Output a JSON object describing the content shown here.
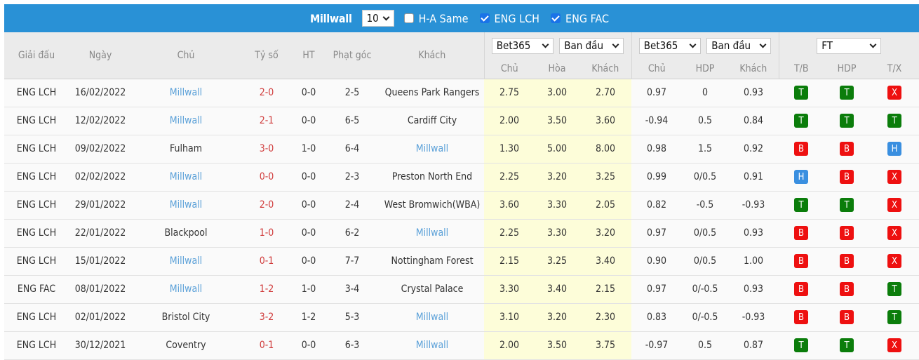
{
  "topbar": {
    "team": "Millwall",
    "count_select": "10",
    "ha_same": {
      "label": "H-A Same",
      "checked": false
    },
    "filters": [
      {
        "label": "ENG LCH",
        "checked": true
      },
      {
        "label": "ENG FAC",
        "checked": true
      }
    ]
  },
  "header": {
    "columns": {
      "league": "Giải đấu",
      "date": "Ngày",
      "home": "Chủ",
      "score": "Tỷ số",
      "ht": "HT",
      "corners": "Phạt góc",
      "away": "Khách"
    },
    "odds_group": {
      "bookmaker_select": "Bet365",
      "type_select": "Ban đầu",
      "sub": [
        "Chủ",
        "Hòa",
        "Khách"
      ]
    },
    "hdp_group": {
      "bookmaker_select": "Bet365",
      "type_select": "Ban đầu",
      "sub": [
        "Chủ",
        "HDP",
        "Khách"
      ]
    },
    "result_group": {
      "period_select": "FT",
      "sub": [
        "T/B",
        "HDP",
        "T/X"
      ]
    }
  },
  "colors": {
    "topbar": "#2991d6",
    "highlight_team": "#5aa0d8",
    "score": "#d03a3a",
    "odds_bg": "#fdfdd9",
    "badge_T": "#0b7d0b",
    "badge_B": "#ee1010",
    "badge_X": "#ee1010",
    "badge_H": "#3a8fe0"
  },
  "rows": [
    {
      "league": "ENG LCH",
      "date": "16/02/2022",
      "home": "Millwall",
      "home_hl": true,
      "score": "2-0",
      "ht": "0-0",
      "corners": "2-5",
      "away": "Queens Park Rangers",
      "away_hl": false,
      "o1": "2.75",
      "ox": "3.00",
      "o2": "2.70",
      "h1": "0.97",
      "hdp": "0",
      "h2": "0.93",
      "tb": "T",
      "hr": "T",
      "tx": "X"
    },
    {
      "league": "ENG LCH",
      "date": "12/02/2022",
      "home": "Millwall",
      "home_hl": true,
      "score": "2-1",
      "ht": "0-0",
      "corners": "6-5",
      "away": "Cardiff City",
      "away_hl": false,
      "o1": "2.00",
      "ox": "3.50",
      "o2": "3.60",
      "h1": "-0.94",
      "hdp": "0.5",
      "h2": "0.84",
      "tb": "T",
      "hr": "T",
      "tx": "T"
    },
    {
      "league": "ENG LCH",
      "date": "09/02/2022",
      "home": "Fulham",
      "home_hl": false,
      "score": "3-0",
      "ht": "1-0",
      "corners": "6-4",
      "away": "Millwall",
      "away_hl": true,
      "o1": "1.30",
      "ox": "5.00",
      "o2": "8.00",
      "h1": "0.98",
      "hdp": "1.5",
      "h2": "0.92",
      "tb": "B",
      "hr": "B",
      "tx": "H"
    },
    {
      "league": "ENG LCH",
      "date": "02/02/2022",
      "home": "Millwall",
      "home_hl": true,
      "score": "0-0",
      "ht": "0-0",
      "corners": "2-3",
      "away": "Preston North End",
      "away_hl": false,
      "o1": "2.25",
      "ox": "3.20",
      "o2": "3.25",
      "h1": "0.99",
      "hdp": "0/0.5",
      "h2": "0.91",
      "tb": "H",
      "hr": "B",
      "tx": "X"
    },
    {
      "league": "ENG LCH",
      "date": "29/01/2022",
      "home": "Millwall",
      "home_hl": true,
      "score": "2-0",
      "ht": "0-0",
      "corners": "2-4",
      "away": "West Bromwich(WBA)",
      "away_hl": false,
      "o1": "3.60",
      "ox": "3.30",
      "o2": "2.05",
      "h1": "0.82",
      "hdp": "-0.5",
      "h2": "-0.93",
      "tb": "T",
      "hr": "T",
      "tx": "X"
    },
    {
      "league": "ENG LCH",
      "date": "22/01/2022",
      "home": "Blackpool",
      "home_hl": false,
      "score": "1-0",
      "ht": "0-0",
      "corners": "6-2",
      "away": "Millwall",
      "away_hl": true,
      "o1": "2.25",
      "ox": "3.30",
      "o2": "3.20",
      "h1": "0.97",
      "hdp": "0/0.5",
      "h2": "0.93",
      "tb": "B",
      "hr": "B",
      "tx": "X"
    },
    {
      "league": "ENG LCH",
      "date": "15/01/2022",
      "home": "Millwall",
      "home_hl": true,
      "score": "0-1",
      "ht": "0-0",
      "corners": "7-7",
      "away": "Nottingham Forest",
      "away_hl": false,
      "o1": "2.15",
      "ox": "3.25",
      "o2": "3.40",
      "h1": "0.90",
      "hdp": "0/0.5",
      "h2": "1.00",
      "tb": "B",
      "hr": "B",
      "tx": "X"
    },
    {
      "league": "ENG FAC",
      "date": "08/01/2022",
      "home": "Millwall",
      "home_hl": true,
      "score": "1-2",
      "ht": "1-0",
      "corners": "3-4",
      "away": "Crystal Palace",
      "away_hl": false,
      "o1": "3.30",
      "ox": "3.40",
      "o2": "2.15",
      "h1": "0.97",
      "hdp": "0/-0.5",
      "h2": "0.93",
      "tb": "B",
      "hr": "B",
      "tx": "T"
    },
    {
      "league": "ENG LCH",
      "date": "02/01/2022",
      "home": "Bristol City",
      "home_hl": false,
      "score": "3-2",
      "ht": "1-2",
      "corners": "5-3",
      "away": "Millwall",
      "away_hl": true,
      "o1": "3.10",
      "ox": "3.20",
      "o2": "2.30",
      "h1": "0.83",
      "hdp": "0/-0.5",
      "h2": "-0.93",
      "tb": "B",
      "hr": "B",
      "tx": "T"
    },
    {
      "league": "ENG LCH",
      "date": "30/12/2021",
      "home": "Coventry",
      "home_hl": false,
      "score": "0-1",
      "ht": "0-0",
      "corners": "6-3",
      "away": "Millwall",
      "away_hl": true,
      "o1": "2.00",
      "ox": "3.50",
      "o2": "3.75",
      "h1": "-0.97",
      "hdp": "0.5",
      "h2": "0.87",
      "tb": "T",
      "hr": "T",
      "tx": "X"
    }
  ]
}
